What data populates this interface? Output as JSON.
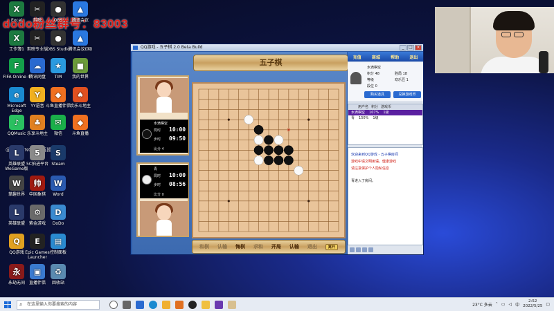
{
  "stream": {
    "group_text": "dodo粉丝群号：83003",
    "watermark": "@WHAYNG进入直播间"
  },
  "desktop": {
    "icons": [
      {
        "label": "Excel",
        "glyph": "X",
        "color": "#1d7a40"
      },
      {
        "label": "剪映",
        "glyph": "✂",
        "color": "#222"
      },
      {
        "label": "OBS",
        "glyph": "●",
        "color": "#333"
      },
      {
        "label": "腾讯会议",
        "glyph": "▲",
        "color": "#2a78e0"
      },
      {
        "label": "工作簿1",
        "glyph": "X",
        "color": "#1d7a40"
      },
      {
        "label": "剪映专业版",
        "glyph": "✂",
        "color": "#222"
      },
      {
        "label": "OBS Studio",
        "glyph": "●",
        "color": "#333"
      },
      {
        "label": "腾讯会议(国)",
        "glyph": "▲",
        "color": "#2a78e0"
      },
      {
        "label": "FIFA Online 4",
        "glyph": "F",
        "color": "#14a04a"
      },
      {
        "label": "腾讯网盘",
        "glyph": "☁",
        "color": "#2a6ad0"
      },
      {
        "label": "TIM",
        "glyph": "★",
        "color": "#2a9ae0"
      },
      {
        "label": "我的世界",
        "glyph": "■",
        "color": "#6a9a3a"
      },
      {
        "label": "Microsoft Edge",
        "glyph": "e",
        "color": "#1a8ad0"
      },
      {
        "label": "YY语音",
        "glyph": "Y",
        "color": "#f0b020"
      },
      {
        "label": "斗鱼直播伴侣",
        "glyph": "◆",
        "color": "#f07020"
      },
      {
        "label": "欢乐斗地主",
        "glyph": "♠",
        "color": "#e05020"
      },
      {
        "label": "QQMusic",
        "glyph": "♪",
        "color": "#2ac060"
      },
      {
        "label": "乐享斗地主",
        "glyph": "♣",
        "color": "#e08020"
      },
      {
        "label": "微信",
        "glyph": "✉",
        "color": "#1ab04a"
      },
      {
        "label": "斗鱼直播",
        "glyph": "◆",
        "color": "#f07020"
      },
      {
        "label": "英雄联盟 WeGame版",
        "glyph": "L",
        "color": "#2a3a6a"
      },
      {
        "label": "5C拍进平台",
        "glyph": "5",
        "color": "#8a8a8a"
      },
      {
        "label": "Steam",
        "glyph": "S",
        "color": "#1a3a6a"
      },
      {
        "label": "掌趣世界",
        "glyph": "W",
        "color": "#444"
      },
      {
        "label": "中国象棋",
        "glyph": "帅",
        "color": "#a01a10"
      },
      {
        "label": "Word",
        "glyph": "W",
        "color": "#2a5ab0"
      },
      {
        "label": "英雄联盟",
        "glyph": "L",
        "color": "#2a3a6a"
      },
      {
        "label": "紫金游戏",
        "glyph": "⚙",
        "color": "#6a6a6a"
      },
      {
        "label": "DoDo",
        "glyph": "D",
        "color": "#3a8ad0"
      },
      {
        "label": "QQ游戏",
        "glyph": "Q",
        "color": "#e0a020"
      },
      {
        "label": "Epic Games Launcher",
        "glyph": "E",
        "color": "#222"
      },
      {
        "label": "控制面板",
        "glyph": "▤",
        "color": "#2a8ad0"
      },
      {
        "label": "永劫无间",
        "glyph": "永",
        "color": "#8a1a1a"
      },
      {
        "label": "直播伴侣",
        "glyph": "▣",
        "color": "#3a7ad0"
      },
      {
        "label": "回收站",
        "glyph": "♻",
        "color": "#5a8ab0"
      }
    ]
  },
  "game": {
    "window_title": "QQ游戏 - 五子棋  2.0 Beta Build",
    "banner": "五子棋",
    "opponent": {
      "name": "水滴棋空",
      "time_label1": "局时",
      "time1": "10:00",
      "time_label2": "步时",
      "time2": "09:50",
      "score": "比分 4",
      "piece": "black"
    },
    "player": {
      "name": "青",
      "time_label1": "局时",
      "time1": "10:00",
      "time_label2": "步时",
      "time2": "08:56",
      "score": "比分 0",
      "piece": "white"
    },
    "board": {
      "size": 15,
      "black": [
        [
          6,
          4
        ],
        [
          7,
          5
        ],
        [
          6,
          6
        ],
        [
          7,
          6
        ],
        [
          8,
          6
        ],
        [
          7,
          7
        ],
        [
          8,
          7
        ],
        [
          9,
          7
        ],
        [
          9,
          6
        ]
      ],
      "white": [
        [
          5,
          3
        ],
        [
          6,
          5
        ],
        [
          6,
          7
        ],
        [
          7,
          7
        ],
        [
          8,
          5
        ],
        [
          10,
          8
        ]
      ],
      "marker": [
        9,
        4
      ]
    },
    "bottom_bar": {
      "b1": "和棋",
      "b2": "认输",
      "b3": "悔棋",
      "b4": "求和",
      "b5": "开局",
      "b6": "认输",
      "b7": "退出",
      "next": "离开"
    },
    "side": {
      "tabs": [
        "充值",
        "商城",
        "帮助",
        "退出"
      ],
      "user": {
        "name": "水滴棋空",
        "score": "积分 48",
        "wins": "胜局 18",
        "level": "等级",
        "coins": "欢乐豆 1",
        "rank": "段位 0"
      },
      "btn1": "购买道具",
      "btn2": "兑换游戏币",
      "list_header": [
        "用户名",
        "积分",
        "游戏币"
      ],
      "rows": [
        {
          "name": "水滴棋空",
          "score": "107%",
          "coin": "1级"
        },
        {
          "name": "青",
          "score": "150%",
          "coin": "1级"
        }
      ],
      "chat": {
        "l1": "欢迎来到QQ游戏 - 五子棋房间",
        "l2": "游戏中请文明用语，健康游戏",
        "l3": "请注意保护个人隐私信息",
        "l4": "青进入了房间。"
      }
    }
  },
  "taskbar": {
    "search_placeholder": "在这里输入你要搜索的内容",
    "temp": "23°C 多云",
    "ime": "中",
    "time": "2:52",
    "date": "2022/5/25"
  }
}
